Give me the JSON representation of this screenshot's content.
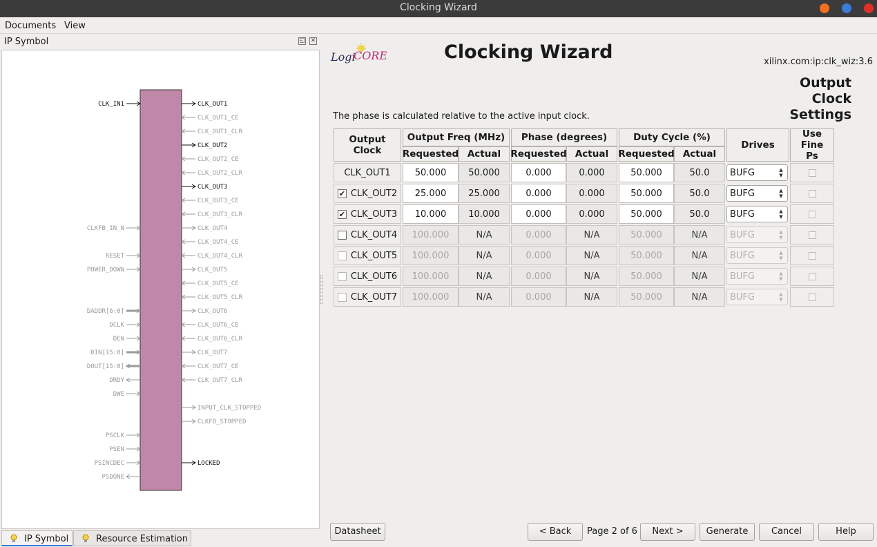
{
  "window": {
    "title": "Clocking Wizard"
  },
  "menubar": {
    "documents": "Documents",
    "view": "View"
  },
  "left_panel": {
    "title": "IP Symbol",
    "tabs": {
      "ip_symbol": "IP Symbol",
      "resource_estimation": "Resource Estimation"
    },
    "inputs": [
      {
        "label": "CLK_IN1",
        "active": true,
        "bus": false,
        "dir": "in"
      },
      {
        "label": "CLKFB_IN_N",
        "active": false,
        "bus": false,
        "dir": "in"
      },
      {
        "label": "RESET",
        "active": false,
        "bus": false,
        "dir": "in"
      },
      {
        "label": "POWER_DOWN",
        "active": false,
        "bus": false,
        "dir": "in"
      },
      {
        "label": "DADDR[6:0]",
        "active": false,
        "bus": true,
        "dir": "in"
      },
      {
        "label": "DCLK",
        "active": false,
        "bus": false,
        "dir": "in"
      },
      {
        "label": "DEN",
        "active": false,
        "bus": false,
        "dir": "in"
      },
      {
        "label": "DIN[15:0]",
        "active": false,
        "bus": true,
        "dir": "in"
      },
      {
        "label": "DOUT[15:0]",
        "active": false,
        "bus": true,
        "dir": "out"
      },
      {
        "label": "DRDY",
        "active": false,
        "bus": false,
        "dir": "out"
      },
      {
        "label": "DWE",
        "active": false,
        "bus": false,
        "dir": "in"
      },
      {
        "label": "PSCLK",
        "active": false,
        "bus": false,
        "dir": "in"
      },
      {
        "label": "PSEN",
        "active": false,
        "bus": false,
        "dir": "in"
      },
      {
        "label": "PSINCDEC",
        "active": false,
        "bus": false,
        "dir": "in"
      },
      {
        "label": "PSDONE",
        "active": false,
        "bus": false,
        "dir": "out"
      }
    ],
    "outputs": [
      {
        "label": "CLK_OUT1",
        "active": true,
        "dir": "out"
      },
      {
        "label": "CLK_OUT1_CE",
        "active": false,
        "dir": "in"
      },
      {
        "label": "CLK_OUT1_CLR",
        "active": false,
        "dir": "in"
      },
      {
        "label": "CLK_OUT2",
        "active": true,
        "dir": "out"
      },
      {
        "label": "CLK_OUT2_CE",
        "active": false,
        "dir": "in"
      },
      {
        "label": "CLK_OUT2_CLR",
        "active": false,
        "dir": "in"
      },
      {
        "label": "CLK_OUT3",
        "active": true,
        "dir": "out"
      },
      {
        "label": "CLK_OUT3_CE",
        "active": false,
        "dir": "in"
      },
      {
        "label": "CLK_OUT3_CLR",
        "active": false,
        "dir": "in"
      },
      {
        "label": "CLK_OUT4",
        "active": false,
        "dir": "out"
      },
      {
        "label": "CLK_OUT4_CE",
        "active": false,
        "dir": "in"
      },
      {
        "label": "CLK_OUT4_CLR",
        "active": false,
        "dir": "in"
      },
      {
        "label": "CLK_OUT5",
        "active": false,
        "dir": "out"
      },
      {
        "label": "CLK_OUT5_CE",
        "active": false,
        "dir": "in"
      },
      {
        "label": "CLK_OUT5_CLR",
        "active": false,
        "dir": "in"
      },
      {
        "label": "CLK_OUT6",
        "active": false,
        "dir": "out"
      },
      {
        "label": "CLK_OUT6_CE",
        "active": false,
        "dir": "in"
      },
      {
        "label": "CLK_OUT6_CLR",
        "active": false,
        "dir": "in"
      },
      {
        "label": "CLK_OUT7",
        "active": false,
        "dir": "out"
      },
      {
        "label": "CLK_OUT7_CE",
        "active": false,
        "dir": "in"
      },
      {
        "label": "CLK_OUT7_CLR",
        "active": false,
        "dir": "in"
      },
      {
        "label": "INPUT_CLK_STOPPED",
        "active": false,
        "dir": "out"
      },
      {
        "label": "CLKFB_STOPPED",
        "active": false,
        "dir": "out"
      },
      {
        "label": "LOCKED",
        "active": true,
        "dir": "out"
      }
    ],
    "block_color": "#bf88a8"
  },
  "header": {
    "logo_text": "LogiCORE",
    "title": "Clocking Wizard",
    "vlnv": "xilinx.com:ip:clk_wiz:3.6",
    "section_title": "Output Clock Settings"
  },
  "phase_note": "The phase is calculated relative to the active input clock.",
  "table": {
    "headers": {
      "output_clock": "Output Clock",
      "output_freq": "Output Freq (MHz)",
      "phase": "Phase (degrees)",
      "duty_cycle": "Duty Cycle (%)",
      "drives": "Drives",
      "use_fine_ps": "Use Fine Ps",
      "requested": "Requested",
      "actual": "Actual"
    },
    "rows": [
      {
        "name": "CLK_OUT1",
        "checkbox": "none",
        "enabled": true,
        "freq_req": "50.000",
        "freq_act": "50.000",
        "phase_req": "0.000",
        "phase_act": "0.000",
        "duty_req": "50.000",
        "duty_act": "50.0",
        "drives": "BUFG"
      },
      {
        "name": "CLK_OUT2",
        "checkbox": "checked",
        "enabled": true,
        "freq_req": "25.000",
        "freq_act": "25.000",
        "phase_req": "0.000",
        "phase_act": "0.000",
        "duty_req": "50.000",
        "duty_act": "50.0",
        "drives": "BUFG"
      },
      {
        "name": "CLK_OUT3",
        "checkbox": "checked",
        "enabled": true,
        "freq_req": "10.000",
        "freq_act": "10.000",
        "phase_req": "0.000",
        "phase_act": "0.000",
        "duty_req": "50.000",
        "duty_act": "50.0",
        "drives": "BUFG"
      },
      {
        "name": "CLK_OUT4",
        "checkbox": "unchecked",
        "enabled": false,
        "freq_req": "100.000",
        "freq_act": "N/A",
        "phase_req": "0.000",
        "phase_act": "N/A",
        "duty_req": "50.000",
        "duty_act": "N/A",
        "drives": "BUFG"
      },
      {
        "name": "CLK_OUT5",
        "checkbox": "disabled",
        "enabled": false,
        "freq_req": "100.000",
        "freq_act": "N/A",
        "phase_req": "0.000",
        "phase_act": "N/A",
        "duty_req": "50.000",
        "duty_act": "N/A",
        "drives": "BUFG"
      },
      {
        "name": "CLK_OUT6",
        "checkbox": "disabled",
        "enabled": false,
        "freq_req": "100.000",
        "freq_act": "N/A",
        "phase_req": "0.000",
        "phase_act": "N/A",
        "duty_req": "50.000",
        "duty_act": "N/A",
        "drives": "BUFG"
      },
      {
        "name": "CLK_OUT7",
        "checkbox": "disabled",
        "enabled": false,
        "freq_req": "100.000",
        "freq_act": "N/A",
        "phase_req": "0.000",
        "phase_act": "N/A",
        "duty_req": "50.000",
        "duty_act": "N/A",
        "drives": "BUFG"
      }
    ]
  },
  "footer": {
    "datasheet": "Datasheet",
    "back": "< Back",
    "page_info": "Page 2 of 6",
    "next": "Next >",
    "generate": "Generate",
    "cancel": "Cancel",
    "help": "Help"
  },
  "colors": {
    "titlebar": "#3b3b3b",
    "close": "#e0302c",
    "maximize": "#3d7bd9",
    "minimize": "#f26f21"
  }
}
